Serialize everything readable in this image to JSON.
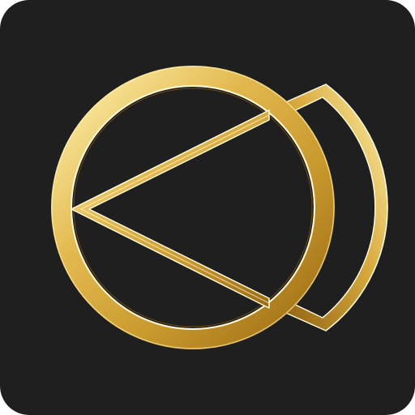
{
  "icon": {
    "name": "gold-ring-triangle-arc-logo",
    "background_color": "#1f1f1f",
    "gold_light": "#fff3b0",
    "gold_mid": "#e3b94f",
    "gold_dark": "#9a6a12",
    "highlight": "#fff8d8"
  }
}
